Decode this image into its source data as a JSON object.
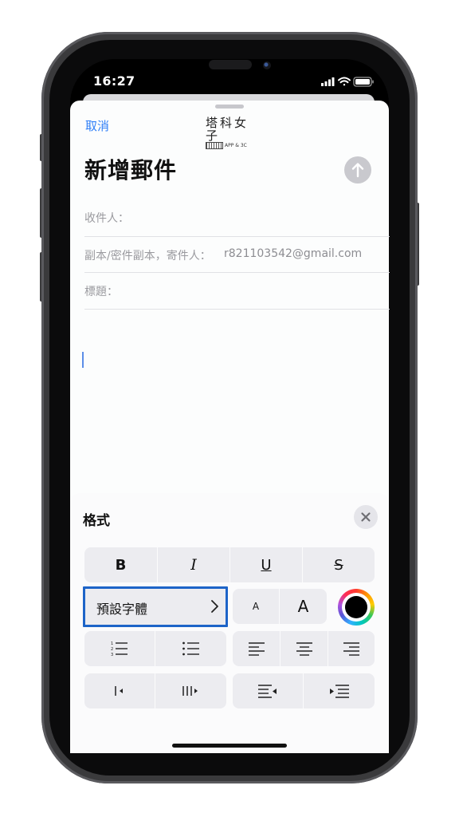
{
  "status": {
    "time": "16:27"
  },
  "compose": {
    "cancel_label": "取消",
    "title": "新增郵件",
    "to_label": "收件人：",
    "cc_label": "副本/密件副本，寄件人：",
    "from_value": "r821103542@gmail.com",
    "subject_label": "標題："
  },
  "logo": {
    "main": "塔科女子",
    "sub": "APP & 3C"
  },
  "format_panel": {
    "title": "格式",
    "style_buttons": [
      "B",
      "I",
      "U",
      "S"
    ],
    "font_button_label": "預設字體",
    "size_small_label": "A",
    "size_large_label": "A",
    "text_color": "#000000"
  },
  "colors": {
    "accent": "#2f7ff7",
    "highlight_border": "#1d64c8"
  },
  "icons": [
    "close-icon",
    "send-arrow-icon",
    "chevron-right-icon",
    "numbered-list-icon",
    "bulleted-list-icon",
    "align-left-icon",
    "align-center-icon",
    "align-right-icon",
    "decrease-indent-icon",
    "increase-indent-icon",
    "outdent-icon",
    "indent-icon",
    "signal-icon",
    "wifi-icon",
    "battery-icon"
  ]
}
